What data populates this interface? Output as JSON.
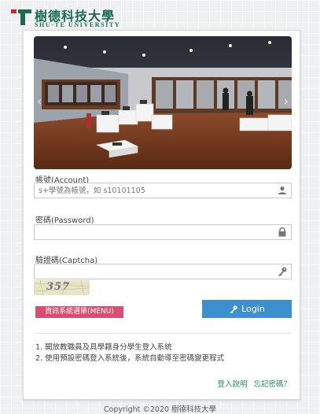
{
  "header": {
    "logo_cn": "樹德科技大學",
    "logo_en": "SHU-TE UNIVERSITY"
  },
  "login": {
    "account_label": "帳號(Account)",
    "account_placeholder": "s+學號為帳號，如 s10101105",
    "account_value": "",
    "password_label": "密碼(Password)",
    "password_value": "",
    "captcha_label": "驗證碼(Captcha)",
    "captcha_value": "",
    "captcha_code": "357",
    "menu_button": "資訊系統選單(MENU)",
    "login_button": "Login"
  },
  "notes": [
    "1. 開放教職員及具學籍身分學生登入系統",
    "2. 使用預設密碼登入系統後，系統自動導至密碼變更程式"
  ],
  "links": {
    "help": "登入說明",
    "forgot": "忘記密碼？"
  },
  "footer": {
    "copyright": "Copyright ©2020 樹德科技大學"
  },
  "colors": {
    "brand_green": "#1b6b4f",
    "login_blue": "#3d8fd0",
    "menu_pink": "#d94f73",
    "link_green": "#2a8a6a"
  },
  "icons": {
    "logo": "university-logo-icon",
    "user": "user-icon",
    "lock": "lock-icon",
    "key": "key-icon"
  }
}
